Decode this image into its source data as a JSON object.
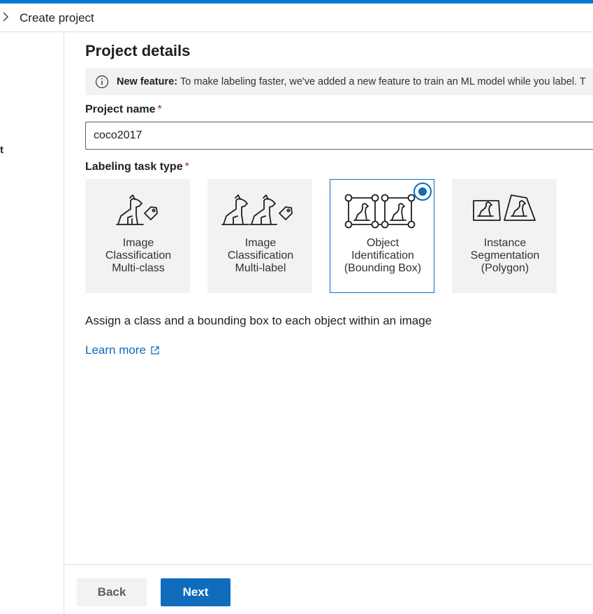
{
  "header": {
    "title": "Create project"
  },
  "left_panel": {
    "stub_text": "t"
  },
  "main": {
    "heading": "Project details",
    "banner": {
      "label": "New feature:",
      "message": "To make labeling faster, we've added a new feature to train an ML model while you label. T"
    },
    "project_name": {
      "label": "Project name",
      "required_mark": "*",
      "value": "coco2017"
    },
    "task_type": {
      "label": "Labeling task type",
      "required_mark": "*",
      "options": [
        {
          "label": "Image\nClassification\nMulti-class",
          "icon": "dog-tag-icon",
          "selected": false
        },
        {
          "label": "Image\nClassification\nMulti-label",
          "icon": "dogs-tag-icon",
          "selected": false
        },
        {
          "label": "Object\nIdentification\n(Bounding Box)",
          "icon": "bounding-box-icon",
          "selected": true
        },
        {
          "label": "Instance\nSegmentation\n(Polygon)",
          "icon": "polygon-icon",
          "selected": false
        }
      ]
    },
    "description": "Assign a class and a bounding box to each object within an image",
    "learn_more": "Learn more"
  },
  "footer": {
    "back_label": "Back",
    "next_label": "Next"
  },
  "colors": {
    "accent": "#0f6cbd",
    "top_bar": "#0078d4",
    "required": "#a4262c"
  }
}
